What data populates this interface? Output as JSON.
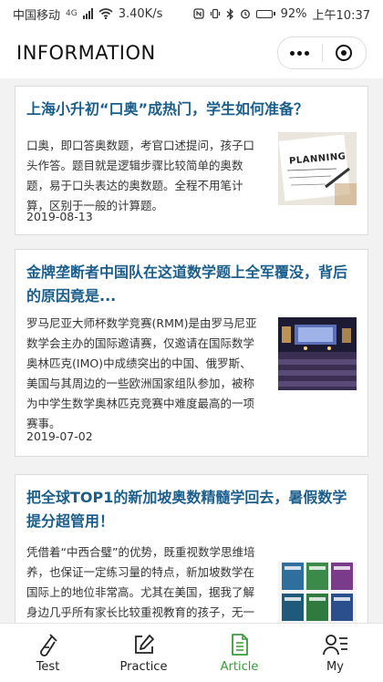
{
  "status_bar": {
    "carrier": "中国移动",
    "network": "4G",
    "speed": "3.40K/s",
    "battery": "92%",
    "battery_level": 0.92,
    "time": "上午10:37"
  },
  "header": {
    "title": "INFORMATION"
  },
  "articles": [
    {
      "title": "上海小升初“口奥”成热门，学生如何准备？",
      "summary": "口奥，即口答奥数题，考官口述提问，孩子口头作答。题目就是逻辑步骤比较简单的奥数题，易于口头表达的奥数题。全程不用笔计算，区别于一般的计算题。",
      "date": "2019-08-13",
      "thumb_text": "PLANNING"
    },
    {
      "title": "金牌垄断者中国队在这道数学题上全军覆没，背后的原因竟是...",
      "summary": "罗马尼亚大师杯数学竞赛(RMM)是由罗马尼亚数学会主办的国际邀请赛，仅邀请在国际数学奥林匹克(IMO)中成绩突出的中国、俄罗斯、美国与其周边的一些欧洲国家组队参加，被称为中学生数学奥林匹克竞赛中难度最高的一项赛事。",
      "date": "2019-07-02"
    },
    {
      "title": "把全球TOP1的新加坡奥数精髓学回去，暑假数学提分超管用！",
      "summary": "凭借着“中西合璧”的优势，既重视数学思维培养，也保证一定练习量的特点，新加坡数学在国际上的地位非常高。尤其在美国，据我了解身边几乎所有家长比较重视教育的孩子，无一例外地刷过或正在刷新加坡数"
    }
  ],
  "tabbar": {
    "items": [
      {
        "label": "Test",
        "icon": "flask-icon"
      },
      {
        "label": "Practice",
        "icon": "pencil-square-icon"
      },
      {
        "label": "Article",
        "icon": "document-icon",
        "active": true
      },
      {
        "label": "My",
        "icon": "user-list-icon"
      }
    ],
    "active_color": "#3a9a3a"
  },
  "colors": {
    "title_blue": "#1b5e8c",
    "background": "#f2f2f2"
  }
}
